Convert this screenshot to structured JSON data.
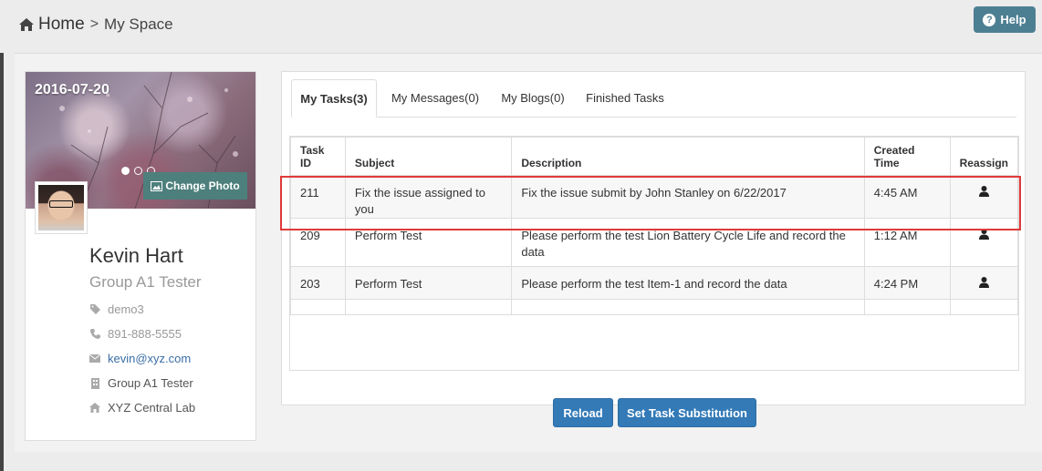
{
  "breadcrumb": {
    "home": "Home",
    "separator": ">",
    "current": "My Space"
  },
  "help": {
    "label": "Help"
  },
  "profile": {
    "banner_date": "2016-07-20",
    "change_photo": "Change Photo",
    "name": "Kevin Hart",
    "group": "Group A1 Tester",
    "tag": "demo3",
    "phone": "891-888-5555",
    "email": "kevin@xyz.com",
    "department": "Group A1 Tester",
    "location": "XYZ Central Lab"
  },
  "tabs": [
    {
      "label": "My Tasks(3)",
      "active": true
    },
    {
      "label": "My Messages(0)",
      "active": false
    },
    {
      "label": "My Blogs(0)",
      "active": false
    },
    {
      "label": "Finished Tasks",
      "active": false
    }
  ],
  "table": {
    "headers": {
      "task_id": "Task ID",
      "subject": "Subject",
      "description": "Description",
      "created_time": "Created Time",
      "reassign": "Reassign"
    },
    "rows": [
      {
        "task_id": "211",
        "subject": "Fix the issue assigned to you",
        "description": "Fix the issue submit by John Stanley on 6/22/2017",
        "created_time": "4:45 AM"
      },
      {
        "task_id": "209",
        "subject": "Perform Test",
        "description": "Please perform the test Lion Battery Cycle Life and record the data",
        "created_time": "1:12 AM"
      },
      {
        "task_id": "203",
        "subject": "Perform Test",
        "description": "Please perform the test Item-1 and record the data",
        "created_time": "4:24 PM"
      }
    ]
  },
  "buttons": {
    "reload": "Reload",
    "substitution": "Set Task Substitution"
  },
  "colors": {
    "primary": "#337ab7",
    "help": "#4d7f93",
    "highlight": "#e03a3a",
    "change_photo": "#4d7f7c"
  }
}
